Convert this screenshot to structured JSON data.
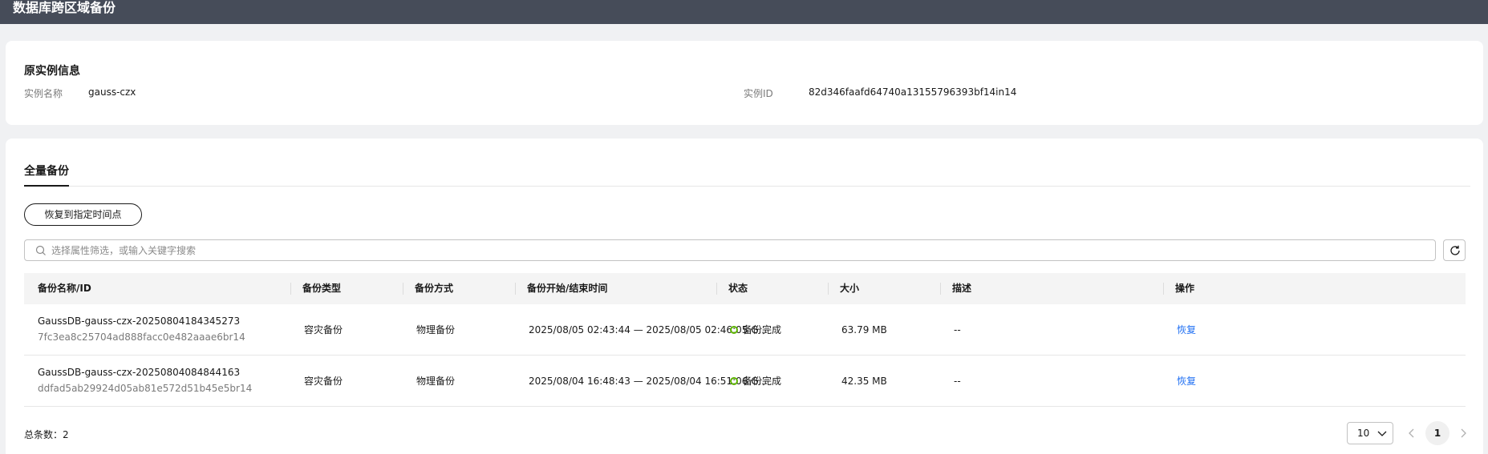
{
  "header": {
    "title": "数据库跨区域备份"
  },
  "instance_info": {
    "section_title": "原实例信息",
    "name_label": "实例名称",
    "name_value": "gauss-czx",
    "id_label": "实例ID",
    "id_value": "82d346faafd64740a13155796393bf14in14"
  },
  "tabs": {
    "active": "全量备份"
  },
  "toolbar": {
    "restore_button": "恢复到指定时间点"
  },
  "search": {
    "placeholder": "选择属性筛选，或输入关键字搜索"
  },
  "table": {
    "columns": [
      "备份名称/ID",
      "备份类型",
      "备份方式",
      "备份开始/结束时间",
      "状态",
      "大小",
      "描述",
      "操作"
    ],
    "rows": [
      {
        "name": "GaussDB-gauss-czx-20250804184345273",
        "id": "7fc3ea8c25704ad888facc0e482aaae6br14",
        "type": "容灾备份",
        "method": "物理备份",
        "time": "2025/08/05 02:43:44 — 2025/08/05 02:46:05 G...",
        "status": "备份完成",
        "size": "63.79 MB",
        "desc": "--",
        "action": "恢复"
      },
      {
        "name": "GaussDB-gauss-czx-20250804084844163",
        "id": "ddfad5ab29924d05ab81e572d51b45e5br14",
        "type": "容灾备份",
        "method": "物理备份",
        "time": "2025/08/04 16:48:43 — 2025/08/04 16:51:06 G...",
        "status": "备份完成",
        "size": "42.35 MB",
        "desc": "--",
        "action": "恢复"
      }
    ]
  },
  "pagination": {
    "total_label": "总条数：2",
    "page_size": "10",
    "current_page": "1"
  },
  "colors": {
    "header_bg": "#464c59",
    "status_success": "#5cb300",
    "link": "#2070f3"
  }
}
